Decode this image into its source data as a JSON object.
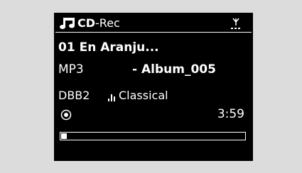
{
  "header": {
    "title_bold": "CD",
    "title_rest": "-Rec",
    "source_icon": "music-note-icon",
    "signal_icon": "antenna-signal-icon"
  },
  "track": {
    "title": "01 En Aranju...",
    "format": "MP3",
    "album": "- Album_005"
  },
  "sound": {
    "dbb": "DBB2",
    "eq_icon": "equalizer-icon",
    "eq": "Classical"
  },
  "playback": {
    "mode_icon": "record-icon",
    "time": "3:59",
    "progress": 0.03
  },
  "colors": {
    "screen": "#000000",
    "text": "#ffffff",
    "background": "#dcdcdc"
  }
}
